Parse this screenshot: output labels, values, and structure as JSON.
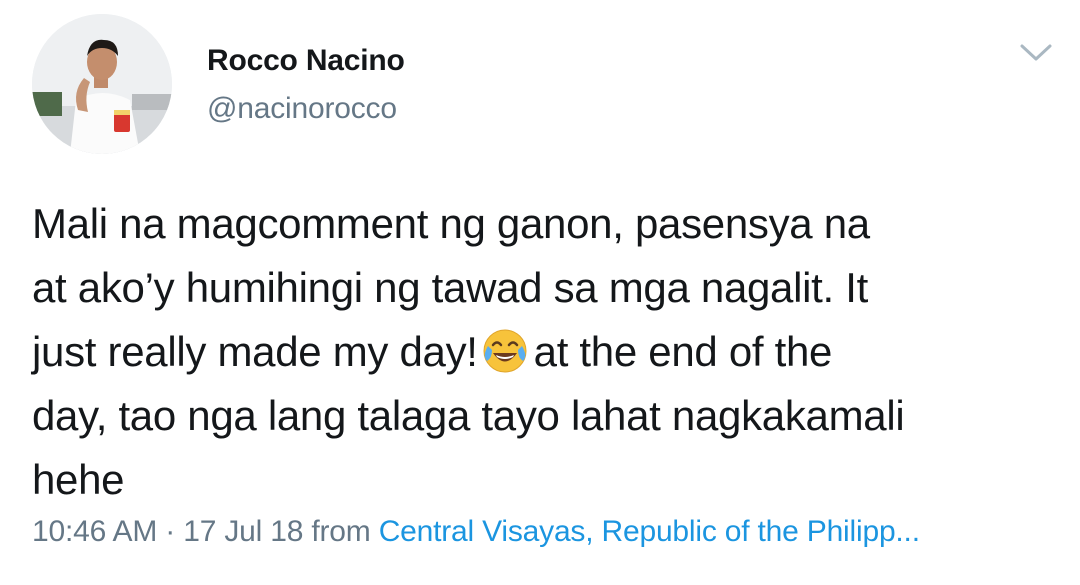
{
  "author": {
    "name": "Rocco Nacino",
    "handle": "@nacinorocco"
  },
  "tweet": {
    "line1": "Mali na magcomment ng ganon, pasensya na",
    "line2": "at ako’y humihingi ng tawad sa mga nagalit. It",
    "line3_before_emoji": "just really made my day!",
    "emoji": "face-with-tears-of-joy-icon",
    "line3_after_emoji": "at the end of the",
    "line4": "day, tao nga lang talaga tayo lahat nagkakamali",
    "line5": "hehe"
  },
  "meta": {
    "time": "10:46 AM",
    "separator": "·",
    "date": "17 Jul 18",
    "from_label": "from",
    "location": "Central Visayas, Republic of the Philipp..."
  },
  "icons": {
    "menu": "chevron-down-icon"
  },
  "colors": {
    "text": "#14171a",
    "secondary": "#657786",
    "link": "#1b95e0",
    "background": "#ffffff"
  }
}
